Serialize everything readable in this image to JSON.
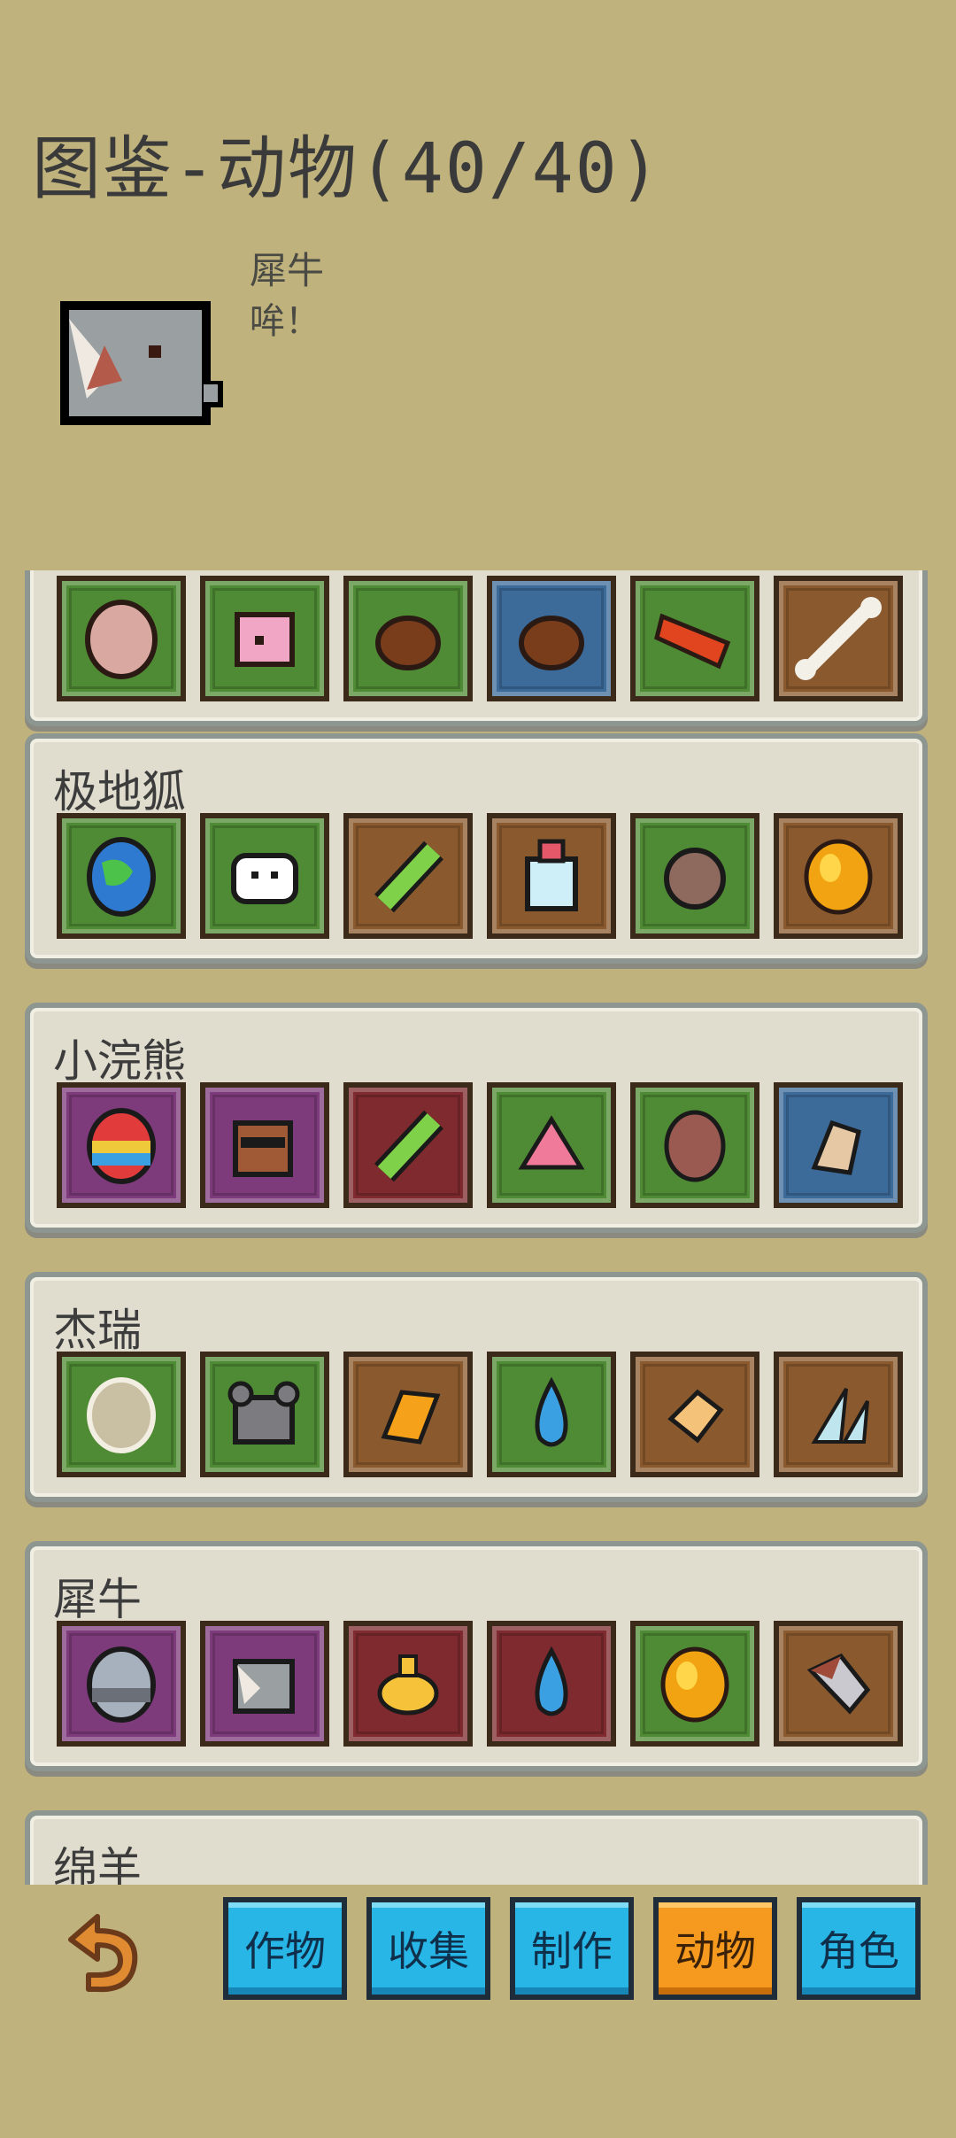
{
  "header": {
    "title": "图鉴-动物(40/40)"
  },
  "preview": {
    "name": "犀牛",
    "description": "哞！",
    "icon": "rhino-icon"
  },
  "groups": [
    {
      "name": "",
      "slots": [
        {
          "icon": "egg-icon",
          "color": "green"
        },
        {
          "icon": "pig-icon",
          "color": "green"
        },
        {
          "icon": "acorn-icon",
          "color": "green"
        },
        {
          "icon": "acorn-icon",
          "color": "blue"
        },
        {
          "icon": "bacon-icon",
          "color": "green"
        },
        {
          "icon": "bone-icon",
          "color": "brown"
        }
      ]
    },
    {
      "name": "极地狐",
      "slots": [
        {
          "icon": "earth-egg-icon",
          "color": "green"
        },
        {
          "icon": "fox-icon",
          "color": "green"
        },
        {
          "icon": "cucumber-icon",
          "color": "brown"
        },
        {
          "icon": "bottle-icon",
          "color": "brown"
        },
        {
          "icon": "urchin-icon",
          "color": "green"
        },
        {
          "icon": "gold-egg-icon",
          "color": "brown"
        }
      ]
    },
    {
      "name": "小浣熊",
      "slots": [
        {
          "icon": "rainbow-egg-icon",
          "color": "purple"
        },
        {
          "icon": "raccoon-icon",
          "color": "purple"
        },
        {
          "icon": "cucumber-icon",
          "color": "red"
        },
        {
          "icon": "pink-gem-icon",
          "color": "green"
        },
        {
          "icon": "meat-icon",
          "color": "green"
        },
        {
          "icon": "ginger-icon",
          "color": "blue"
        }
      ]
    },
    {
      "name": "杰瑞",
      "slots": [
        {
          "icon": "egg-icon",
          "color": "green"
        },
        {
          "icon": "mouse-icon",
          "color": "green"
        },
        {
          "icon": "honeycomb-icon",
          "color": "brown"
        },
        {
          "icon": "water-drop-icon",
          "color": "green"
        },
        {
          "icon": "cheese-icon",
          "color": "brown"
        },
        {
          "icon": "crystal-icon",
          "color": "brown"
        }
      ]
    },
    {
      "name": "犀牛",
      "slots": [
        {
          "icon": "metal-egg-icon",
          "color": "purple"
        },
        {
          "icon": "rhino-icon",
          "color": "purple"
        },
        {
          "icon": "oil-lamp-icon",
          "color": "red"
        },
        {
          "icon": "water-drop-icon",
          "color": "red"
        },
        {
          "icon": "gold-egg-icon",
          "color": "green"
        },
        {
          "icon": "horn-icon",
          "color": "brown"
        }
      ]
    },
    {
      "name": "绵羊",
      "slots": []
    }
  ],
  "tabs": [
    {
      "label": "作物"
    },
    {
      "label": "收集"
    },
    {
      "label": "制作"
    },
    {
      "label": "动物",
      "active": true
    },
    {
      "label": "角色"
    }
  ],
  "colors": {
    "background": "#bfb27c",
    "tab": "#27b6e6",
    "tab_active": "#f59a1f"
  }
}
